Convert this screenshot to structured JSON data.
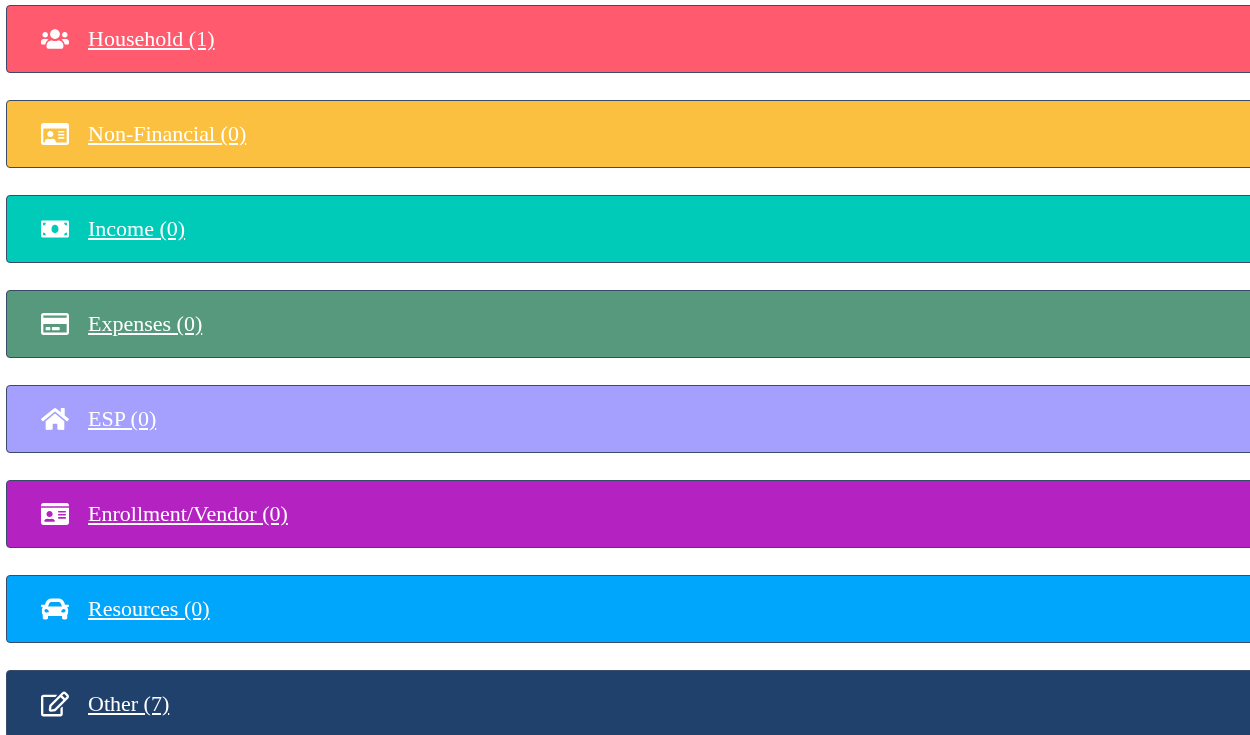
{
  "panels": [
    {
      "label": "Household (1)",
      "color": "#ff5a6e"
    },
    {
      "label": "Non-Financial (0)",
      "color": "#fcc040"
    },
    {
      "label": "Income (0)",
      "color": "#00cbb9"
    },
    {
      "label": "Expenses (0)",
      "color": "#56997d"
    },
    {
      "label": "ESP (0)",
      "color": "#a59ffd"
    },
    {
      "label": "Enrollment/Vendor (0)",
      "color": "#b522c2"
    },
    {
      "label": "Resources (0)",
      "color": "#00a6fc"
    },
    {
      "label": "Other (7)",
      "color": "#21416d"
    }
  ]
}
